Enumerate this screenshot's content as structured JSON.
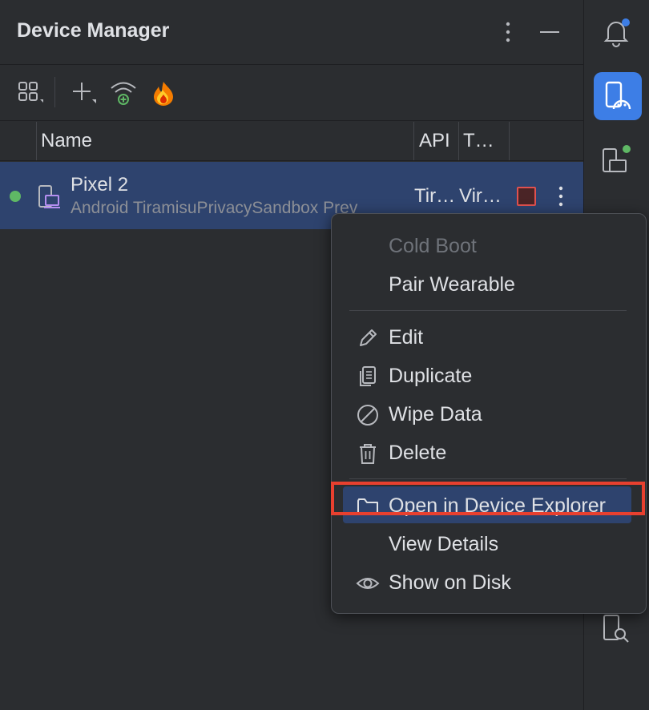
{
  "header": {
    "title": "Device Manager"
  },
  "table": {
    "columns": [
      "Name",
      "API",
      "T…"
    ],
    "rows": [
      {
        "name": "Pixel 2",
        "subtitle": "Android TiramisuPrivacySandbox Prev",
        "api": "Tir…",
        "type": "Vir…",
        "status": "running"
      }
    ]
  },
  "context_menu": {
    "items": [
      {
        "label": "Cold Boot",
        "enabled": false
      },
      {
        "label": "Pair Wearable",
        "enabled": true
      },
      {
        "label": "Edit",
        "icon": "pencil-icon",
        "enabled": true
      },
      {
        "label": "Duplicate",
        "icon": "duplicate-icon",
        "enabled": true
      },
      {
        "label": "Wipe Data",
        "icon": "prohibited-icon",
        "enabled": true
      },
      {
        "label": "Delete",
        "icon": "trash-icon",
        "enabled": true
      },
      {
        "label": "Open in Device Explorer",
        "icon": "folder-icon",
        "enabled": true,
        "highlighted": true
      },
      {
        "label": "View Details",
        "enabled": true
      },
      {
        "label": "Show on Disk",
        "icon": "eye-icon",
        "enabled": true
      }
    ]
  },
  "colors": {
    "background": "#2b2d30",
    "selection": "#2e436e",
    "accent": "#3d7ee6",
    "running": "#5fb865",
    "stop": "#e0514f",
    "callout": "#e8402f"
  }
}
